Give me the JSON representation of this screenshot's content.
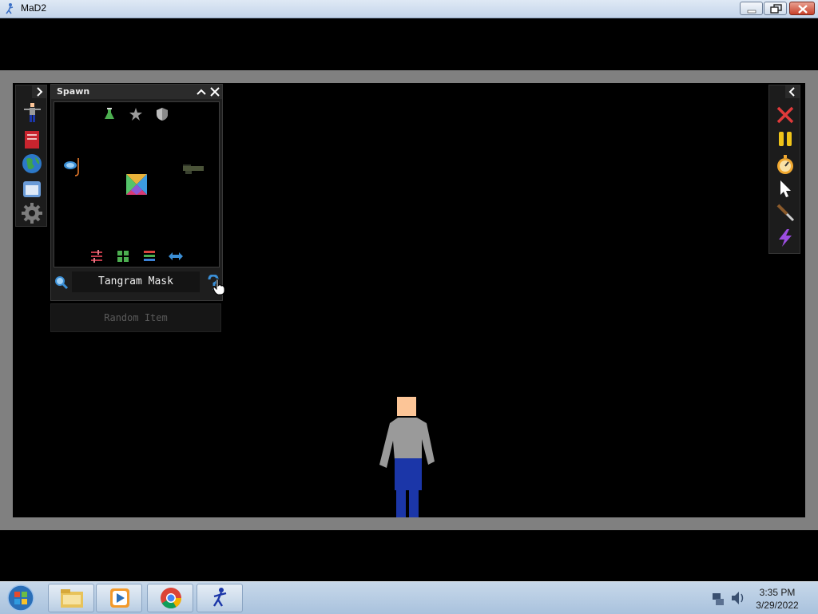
{
  "window": {
    "title": "MaD2",
    "controls": [
      "minimize",
      "maximize",
      "close"
    ]
  },
  "left_toolbar": {
    "expand_icon": "chevron-right-icon",
    "tools": [
      "ragdoll-icon",
      "book-icon",
      "globe-icon",
      "window-icon",
      "gear-icon"
    ]
  },
  "spawn_panel": {
    "title": "Spawn",
    "header_buttons": [
      "collapse-up-icon",
      "close-icon"
    ],
    "category_icons": [
      "flask-icon",
      "star-icon",
      "shield-icon"
    ],
    "items": [
      "snorkel-mask-icon",
      "tangram-mask-icon",
      "rifle-icon"
    ],
    "view_icons": [
      "filter-icon",
      "grid-view-icon",
      "list-view-icon",
      "swap-icon"
    ],
    "search_value": "Tangram Mask",
    "random_label": "Random Item"
  },
  "right_toolbar": {
    "collapse_icon": "chevron-left-icon",
    "tools": [
      "delete-icon",
      "pause-icon",
      "stopwatch-icon",
      "cursor-icon",
      "knife-icon",
      "lightning-icon"
    ]
  },
  "colors": {
    "frame": "#808080",
    "viewport": "#000000",
    "panel": "#1e1e1e",
    "shirt": "#9a9a9a",
    "pants": "#1b36a8",
    "skin": "#fcc597"
  },
  "taskbar": {
    "apps": [
      "explorer-icon",
      "media-player-icon",
      "chrome-icon",
      "mad2-icon"
    ],
    "time": "3:35 PM",
    "date": "3/29/2022"
  }
}
